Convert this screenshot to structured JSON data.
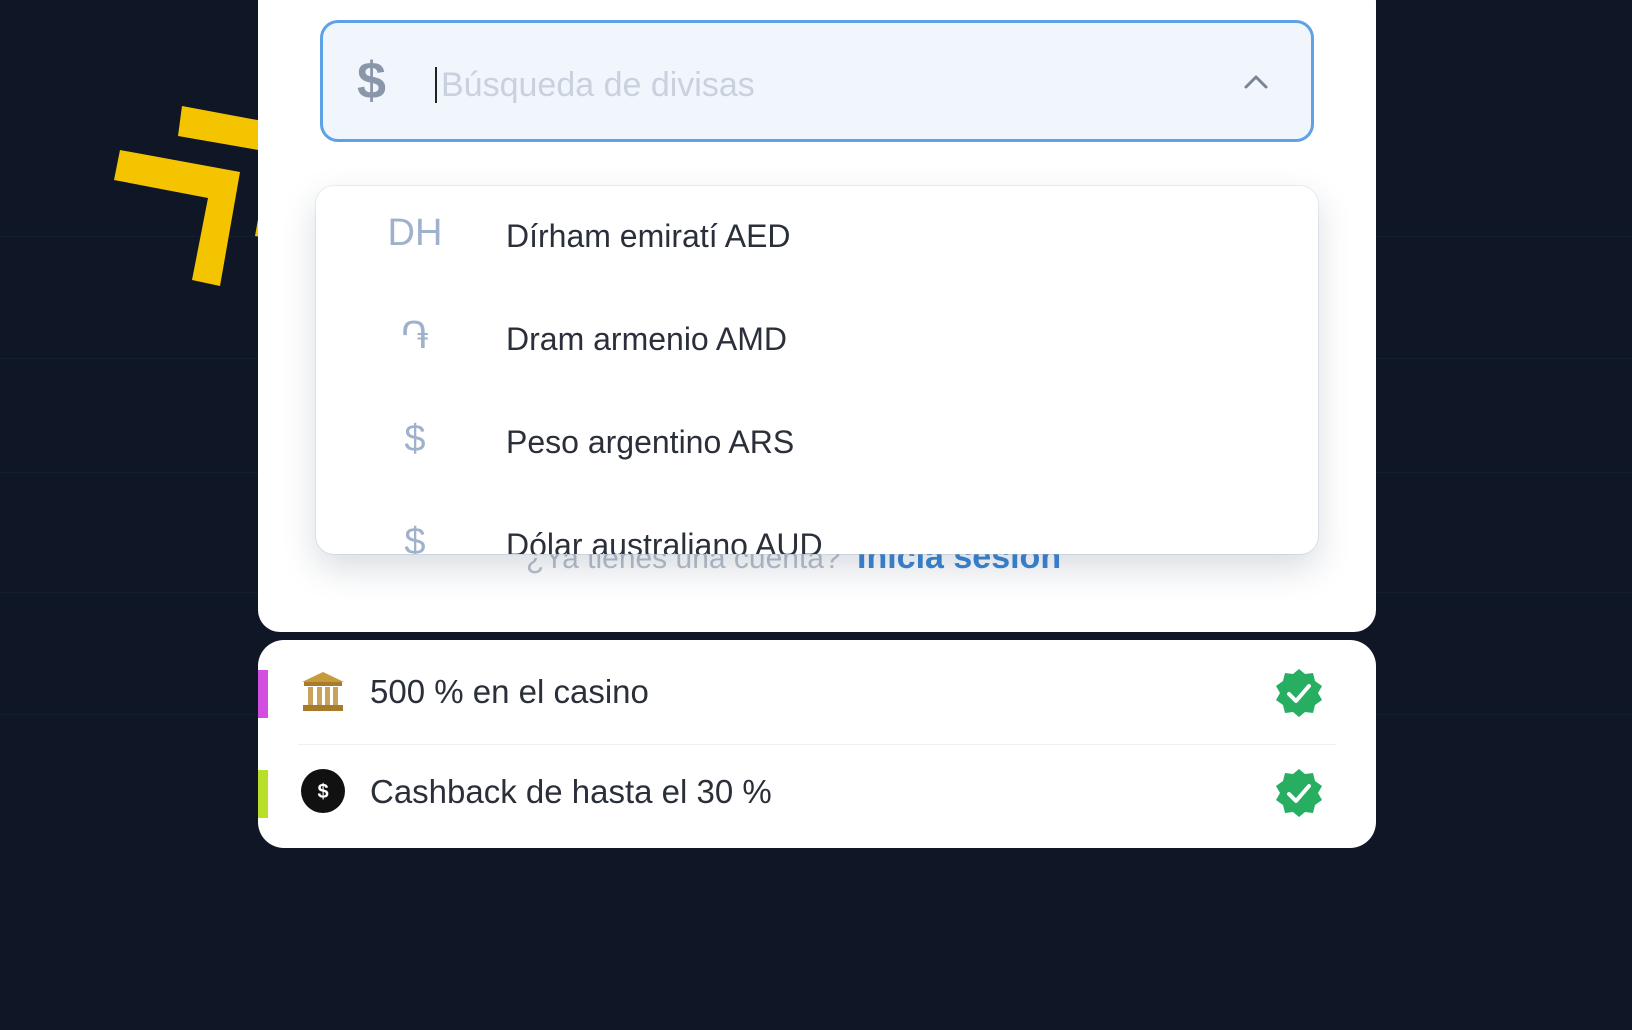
{
  "currency_search": {
    "symbol": "$",
    "placeholder": "Búsqueda de divisas",
    "value": ""
  },
  "currency_options": [
    {
      "symbol": "DH",
      "label": "Dírham emiratí AED"
    },
    {
      "symbol": "֏",
      "label": "Dram armenio AMD"
    },
    {
      "symbol": "$",
      "label": "Peso argentino ARS"
    },
    {
      "symbol": "$",
      "label": "Dólar australiano AUD"
    }
  ],
  "login_hint": {
    "text": "¿Ya tienes una cuenta?",
    "link": "Inicia sesión"
  },
  "bonuses": [
    {
      "label": "500 % en el casino",
      "accent": "#d14ee0",
      "icon": "casino-icon",
      "checked": true
    },
    {
      "label": "Cashback de hasta el 30 %",
      "accent": "#b8e02a",
      "icon": "cashback-icon",
      "checked": true
    }
  ],
  "colors": {
    "background": "#0f1626",
    "focus_border": "#5ea2e6",
    "check_green": "#27ae60",
    "arrow_yellow": "#f5c400"
  }
}
